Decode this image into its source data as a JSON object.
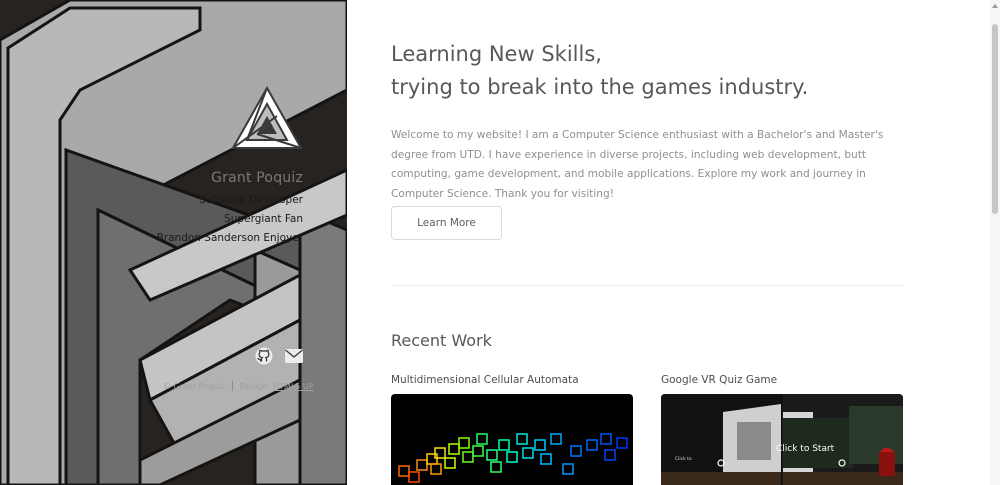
{
  "sidebar": {
    "author": "Grant Poquiz",
    "taglines": [
      "Software Developer",
      "Supergiant Fan",
      "Brandon Sanderson Enjoyer"
    ],
    "social": [
      {
        "icon": "github-icon"
      },
      {
        "icon": "envelope-icon"
      }
    ],
    "footer": {
      "copyright": "© Grant Poquiz",
      "design_label": "Design:",
      "design_link": "HTML5 UP"
    }
  },
  "main": {
    "headline_line1": "Learning New Skills,",
    "headline_line2": "trying to break into the games industry.",
    "intro": "Welcome to my website! I am a Computer Science enthusiast with a Bachelor's and Master's degree from UTD. I have experience in diverse projects, including web development, butt computing, game development, and mobile applications. Explore my work and journey in Computer Science. Thank you for visiting!",
    "cta_label": "Learn More",
    "recent_work_title": "Recent Work",
    "works": [
      {
        "title": "Multidimensional Cellular Automata"
      },
      {
        "title": "Google VR Quiz Game",
        "overlay_text": "Click to Start",
        "small_text": "Click to"
      }
    ]
  },
  "colors": {
    "sidebar_bg": "#262320",
    "panel_gray": "#8e8e8e",
    "heading": "#585858",
    "body_text": "#8f8f8f"
  }
}
